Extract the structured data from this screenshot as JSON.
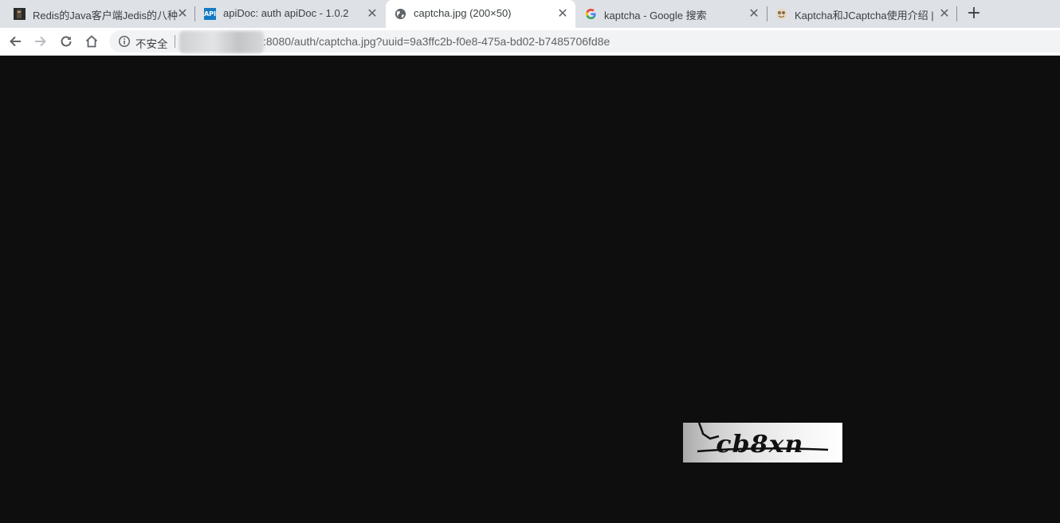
{
  "browser": {
    "tabs": [
      {
        "title": "Redis的Java客户端Jedis的八种调",
        "active": false
      },
      {
        "title": "apiDoc: auth apiDoc - 1.0.2",
        "active": false
      },
      {
        "title": "captcha.jpg (200×50)",
        "active": true
      },
      {
        "title": "kaptcha - Google 搜索",
        "active": false
      },
      {
        "title": "Kaptcha和JCaptcha使用介绍 | T",
        "active": false
      }
    ],
    "new_tab_label": "+",
    "close_glyph": "✕",
    "security_label": "不安全",
    "url": ":8080/auth/captcha.jpg?uuid=9a3ffc2b-f0e8-475a-bd02-b7485706fd8e",
    "favicon_api_text": "API"
  },
  "content": {
    "captcha_text": "cb8xn"
  },
  "colors": {
    "page_background": "#0e0e0e",
    "tabstrip": "#dee1e6",
    "active_tab": "#ffffff"
  }
}
